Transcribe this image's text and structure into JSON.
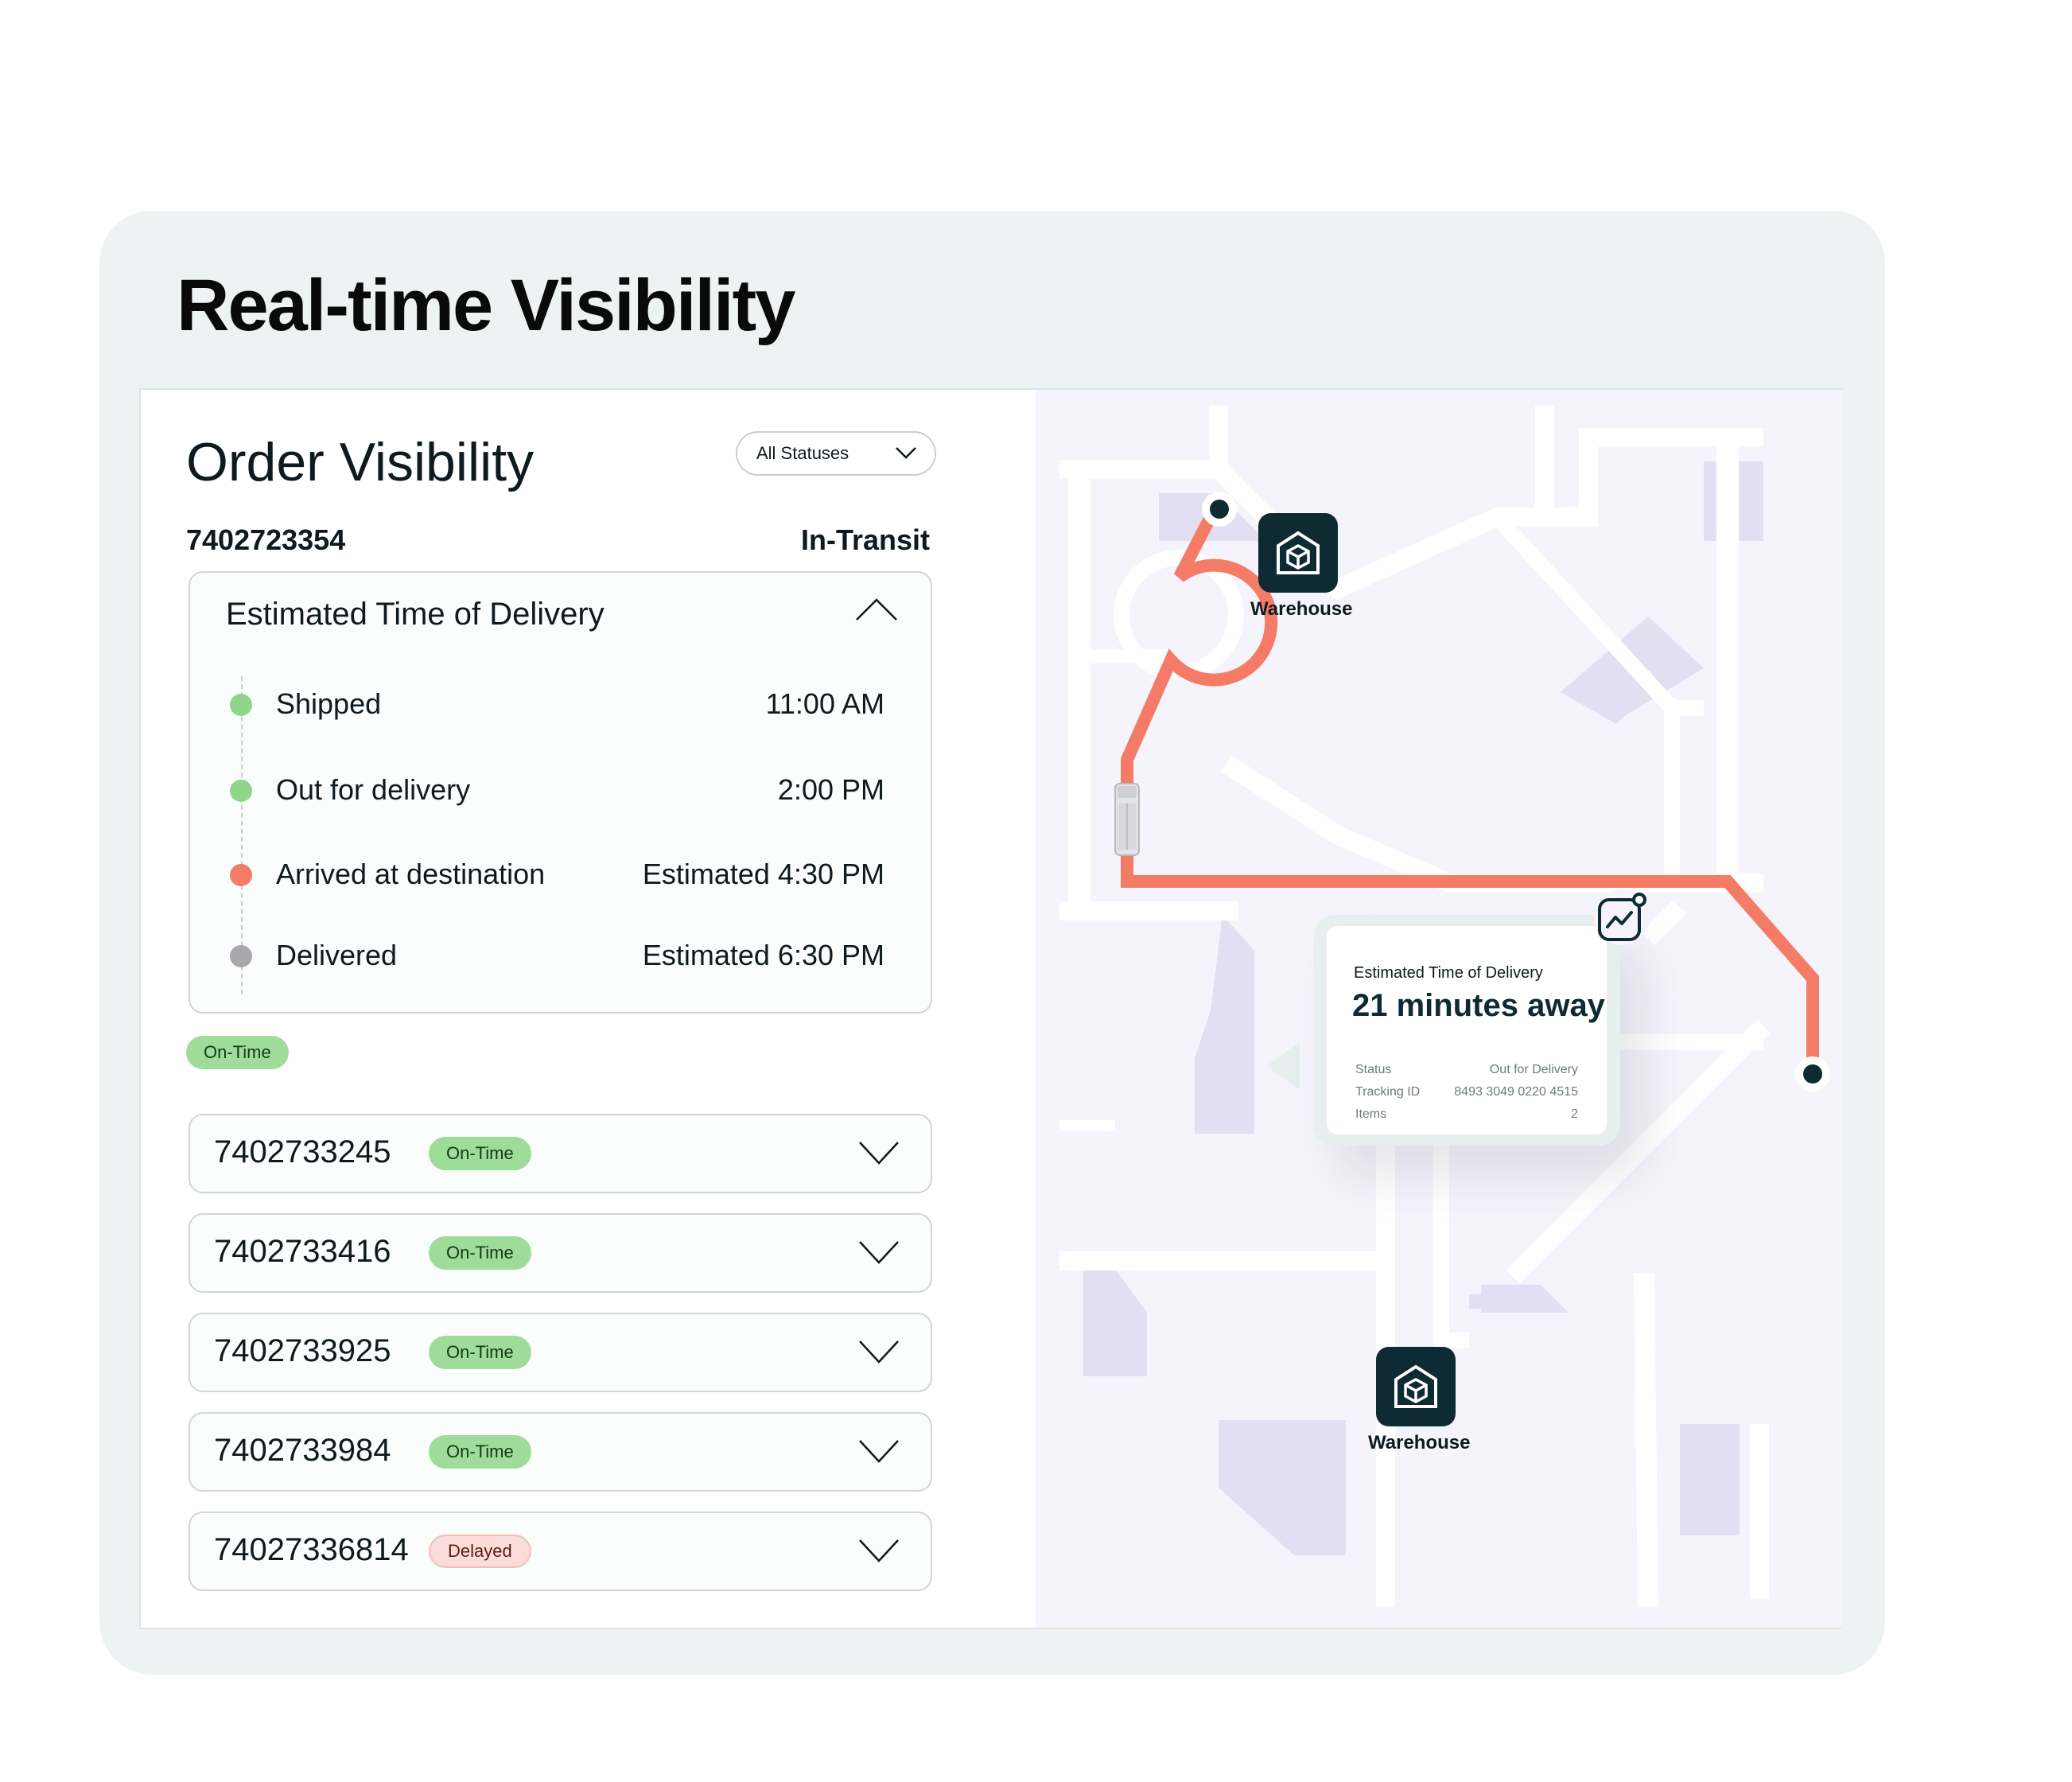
{
  "hero": {
    "title": "Real-time Visibility"
  },
  "order_panel": {
    "title": "Order Visibility",
    "status_filter": {
      "selected": "All Statuses",
      "icon": "chevron-down-icon"
    },
    "active_order": {
      "id": "7402723354",
      "status": "In-Transit",
      "badge": "On-Time",
      "eta": {
        "title": "Estimated Time of Delivery",
        "toggle_icon": "chevron-up-icon",
        "steps": [
          {
            "label": "Shipped",
            "time": "11:00 AM",
            "color": "#8fd68b"
          },
          {
            "label": "Out for delivery",
            "time": "2:00 PM",
            "color": "#8fd68b"
          },
          {
            "label": "Arrived at destination",
            "time": "Estimated 4:30 PM",
            "color": "#f47c66"
          },
          {
            "label": "Delivered",
            "time": "Estimated 6:30 PM",
            "color": "#a9a9ad"
          }
        ]
      }
    },
    "orders": [
      {
        "id": "7402733245",
        "badge": "On-Time",
        "status_type": "on-time"
      },
      {
        "id": "7402733416",
        "badge": "On-Time",
        "status_type": "on-time"
      },
      {
        "id": "7402733925",
        "badge": "On-Time",
        "status_type": "on-time"
      },
      {
        "id": "7402733984",
        "badge": "On-Time",
        "status_type": "on-time"
      },
      {
        "id": "74027336814",
        "badge": "Delayed",
        "status_type": "delayed"
      }
    ]
  },
  "map": {
    "warehouse_top": {
      "label": "Warehouse",
      "icon": "warehouse-box-icon"
    },
    "warehouse_bottom": {
      "label": "Warehouse",
      "icon": "warehouse-box-icon"
    },
    "vehicle_icon": "truck-icon",
    "route_color": "#f47c66",
    "eta_popup": {
      "caption": "Estimated Time of Delivery",
      "headline": "21 minutes away",
      "icon": "analytics-chart-icon",
      "details": [
        {
          "key": "Status",
          "value": "Out for Delivery"
        },
        {
          "key": "Tracking ID",
          "value": "8493 3049 0220 4515"
        },
        {
          "key": "Items",
          "value": "2"
        }
      ]
    }
  },
  "colors": {
    "on_time_badge": "#9fdc9a",
    "delayed_badge": "#fbdcd8",
    "map_background": "#f5f3fb",
    "map_blocks": "#e1dff1",
    "dark_accent": "#0e2b33"
  }
}
